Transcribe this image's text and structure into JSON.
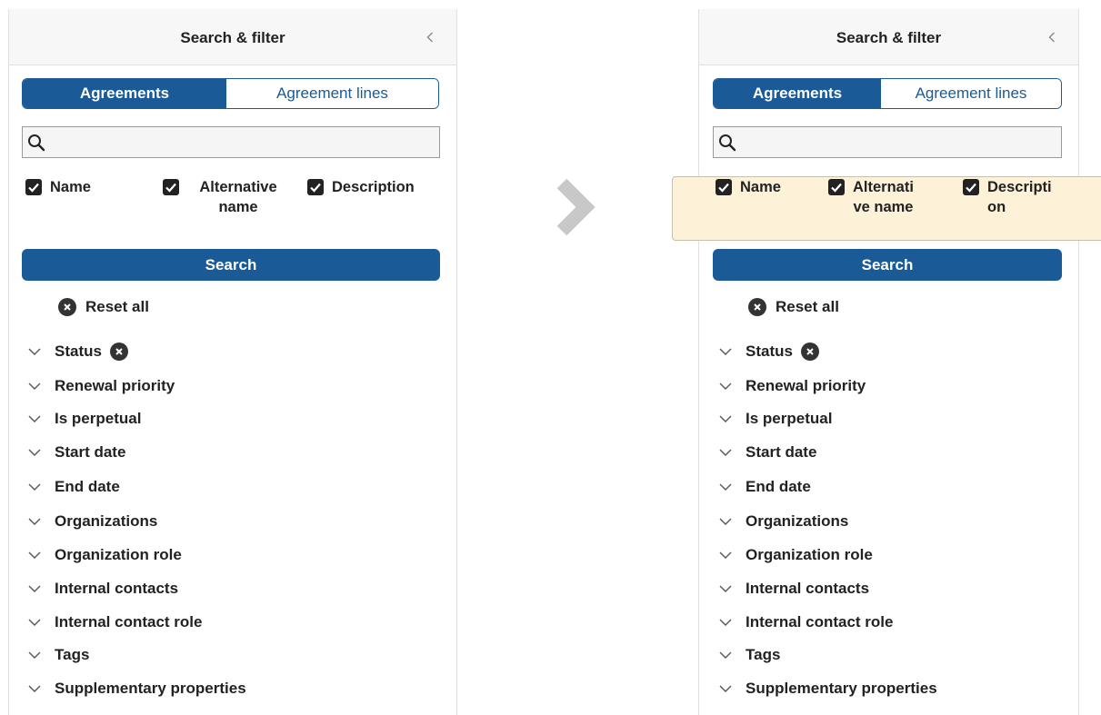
{
  "left_panel": {
    "title": "Search & filter",
    "tabs": [
      {
        "label": "Agreements",
        "active": true
      },
      {
        "label": "Agreement lines",
        "active": false
      }
    ],
    "search_input": {
      "value": "",
      "placeholder": ""
    },
    "fields": [
      {
        "label": "Name",
        "checked": true
      },
      {
        "label": "Alternative name",
        "checked": true
      },
      {
        "label": "Description",
        "checked": true
      }
    ],
    "search_button": "Search",
    "reset_all": "Reset all",
    "filters": [
      "Status",
      "Renewal priority",
      "Is perpetual",
      "Start date",
      "End date",
      "Organizations",
      "Organization role",
      "Internal contacts",
      "Internal contact role",
      "Tags",
      "Supplementary properties"
    ]
  },
  "right_panel": {
    "title": "Search & filter",
    "tabs": [
      {
        "label": "Agreements",
        "active": true
      },
      {
        "label": "Agreement lines",
        "active": false
      }
    ],
    "search_input": {
      "value": "",
      "placeholder": ""
    },
    "fields": [
      {
        "label": "Name",
        "checked": true,
        "lines": [
          "Name"
        ]
      },
      {
        "label": "Alternative name",
        "checked": true,
        "lines": [
          "Alternati",
          "ve name"
        ]
      },
      {
        "label": "Description",
        "checked": true,
        "lines": [
          "Descripti",
          "on"
        ]
      }
    ],
    "search_button": "Search",
    "reset_all": "Reset all",
    "filters": [
      "Status",
      "Renewal priority",
      "Is perpetual",
      "Start date",
      "End date",
      "Organizations",
      "Organization role",
      "Internal contacts",
      "Internal contact role",
      "Tags",
      "Supplementary properties"
    ]
  },
  "icons": {
    "collapse": "chevron-left-icon",
    "search": "magnifier-icon",
    "checkbox": "checkbox-checked-icon",
    "clear": "x-circle-icon",
    "expand": "chevron-down-icon",
    "transition": "arrow-right-icon"
  },
  "colors": {
    "primary": "#1a5a96",
    "highlight": "#fdf2d8",
    "text": "#222222",
    "arrow": "#c8c8c8"
  }
}
